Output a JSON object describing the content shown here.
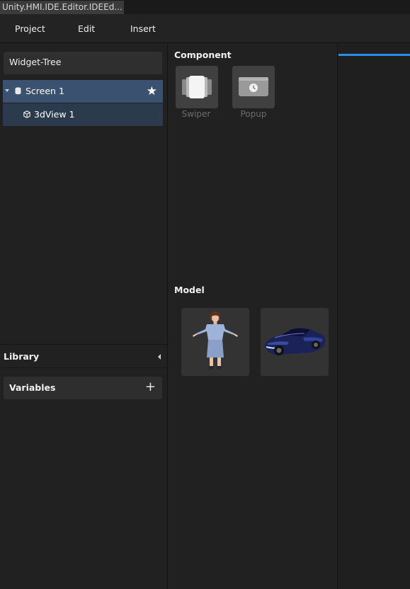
{
  "window": {
    "tab_title": "Unity.HMI.IDE.Editor.IDEEd..."
  },
  "menu": {
    "items": [
      "Project",
      "Edit",
      "Insert"
    ]
  },
  "left": {
    "widget_tree_title": "Widget-Tree",
    "tree": [
      {
        "label": "Screen 1",
        "icon": "database-icon",
        "expanded": true,
        "starred": true
      },
      {
        "label": "3dView 1",
        "icon": "cube-icon"
      }
    ],
    "library_title": "Library",
    "variables_title": "Variables"
  },
  "middle": {
    "component_title": "Component",
    "components": [
      {
        "label": "Swiper",
        "icon": "swiper-icon"
      },
      {
        "label": "Popup",
        "icon": "popup-icon"
      }
    ],
    "model_title": "Model",
    "models": [
      {
        "icon": "female-character-model-thumbnail"
      },
      {
        "icon": "blue-sports-car-model-thumbnail"
      }
    ]
  },
  "colors": {
    "selected_row": "#3a5170",
    "child_row": "#2b3a4d",
    "accent": "#2d8ce6"
  }
}
